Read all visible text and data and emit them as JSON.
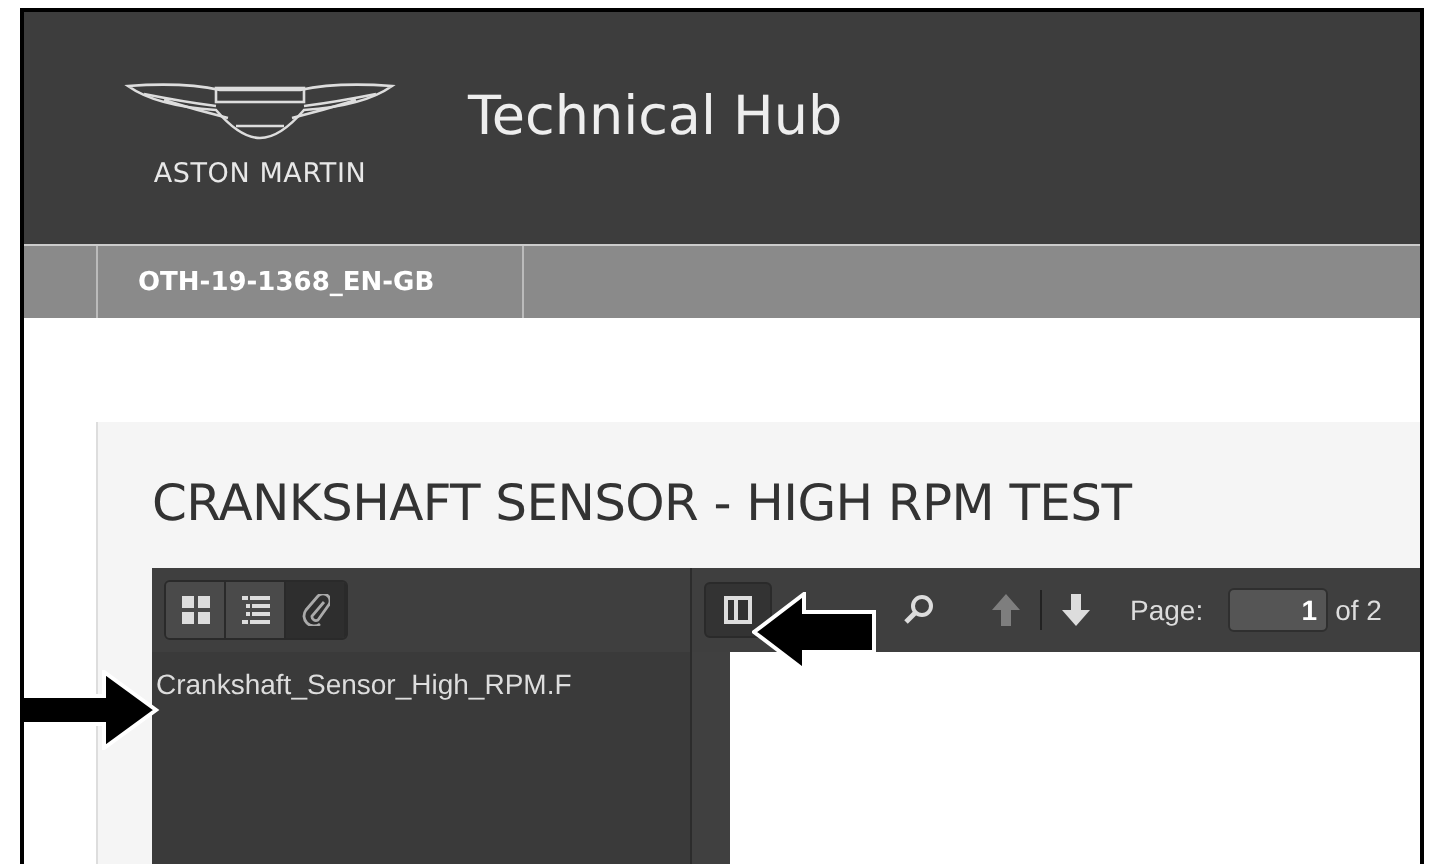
{
  "header": {
    "logo_text": "ASTON MARTIN",
    "title": "Technical Hub"
  },
  "tabs": [
    {
      "label": "OTH-19-1368_EN-GB",
      "selected": true
    }
  ],
  "document": {
    "title": "CRANKSHAFT SENSOR - HIGH RPM TEST"
  },
  "viewer": {
    "sidebar_buttons": [
      {
        "kind": "thumbnails",
        "selected": false
      },
      {
        "kind": "outline",
        "selected": false
      },
      {
        "kind": "attachments",
        "selected": true
      }
    ],
    "attachments": [
      "Crankshaft_Sensor_High_RPM.F"
    ],
    "toolbar_buttons": [
      {
        "kind": "sidebar",
        "disabled": false
      },
      {
        "kind": "search",
        "disabled": false
      },
      {
        "kind": "previous",
        "disabled": true
      },
      {
        "kind": "next",
        "disabled": false
      }
    ],
    "page_label": "Page:",
    "page_value": "1",
    "page_total": "of 2"
  }
}
